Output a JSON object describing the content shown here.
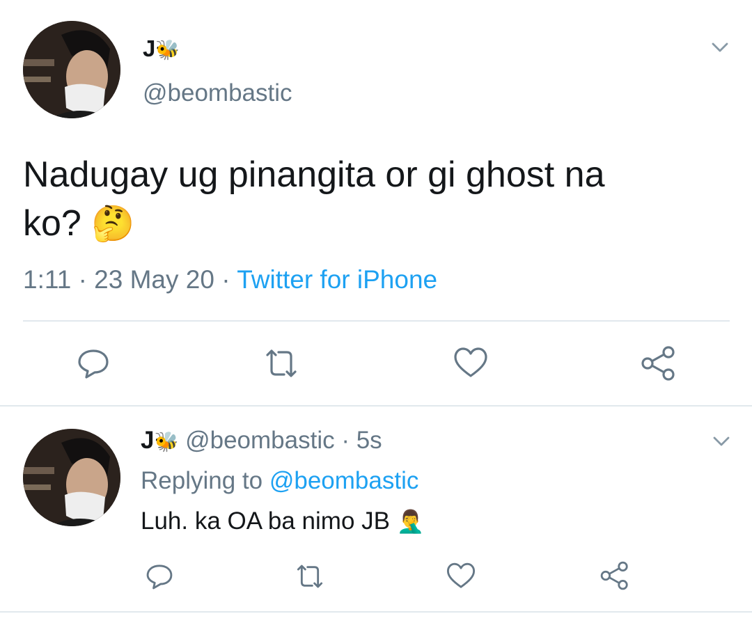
{
  "main_tweet": {
    "author_name": "J",
    "author_emoji": "🐝",
    "handle": "@beombastic",
    "text_line1": "Nadugay ug pinangita or gi ghost na",
    "text_line2": "ko?",
    "text_emoji": "🤔",
    "time": "1:11",
    "sep1": "·",
    "date": "23 May 20",
    "sep2": "·",
    "source": "Twitter for iPhone",
    "actions": [
      "reply-icon",
      "retweet-icon",
      "like-icon",
      "share-icon"
    ]
  },
  "reply_tweet": {
    "author_name": "J",
    "author_emoji": "🐝",
    "handle": "@beombastic",
    "sep": "·",
    "age": "5s",
    "replying_prefix": "Replying to",
    "replying_handle": "@beombastic",
    "text": "Luh. ka OA ba nimo JB",
    "text_emoji": "🤦‍♂️",
    "actions": [
      "reply-icon",
      "retweet-icon",
      "like-icon",
      "share-icon"
    ]
  },
  "colors": {
    "text": "#14171a",
    "muted": "#657786",
    "link": "#1da1f2",
    "divider": "#e1e8ed",
    "icon": "#657786"
  }
}
